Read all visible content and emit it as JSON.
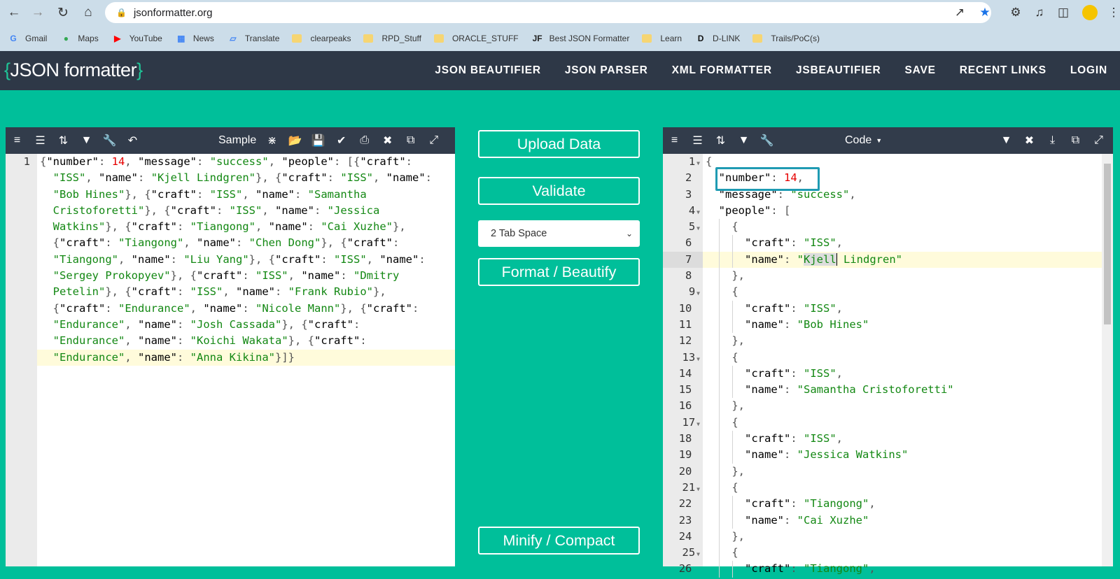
{
  "browser": {
    "url": "jsonformatter.org",
    "bookmarks": [
      {
        "label": "Gmail",
        "icon": "G"
      },
      {
        "label": "Maps",
        "icon": "maps"
      },
      {
        "label": "YouTube",
        "icon": "youtube"
      },
      {
        "label": "News",
        "icon": "news"
      },
      {
        "label": "Translate",
        "icon": "translate"
      },
      {
        "label": "clearpeaks",
        "icon": "folder"
      },
      {
        "label": "RPD_Stuff",
        "icon": "folder"
      },
      {
        "label": "ORACLE_STUFF",
        "icon": "folder"
      },
      {
        "label": "Best JSON Formatter",
        "icon": "JF"
      },
      {
        "label": "Learn",
        "icon": "folder"
      },
      {
        "label": "D-LINK",
        "icon": "D"
      },
      {
        "label": "Trails/PoC(s)",
        "icon": "folder"
      }
    ]
  },
  "site": {
    "logo_open": "{",
    "logo_text": "JSON formatter",
    "logo_close": "}",
    "nav": [
      "JSON BEAUTIFIER",
      "JSON PARSER",
      "XML FORMATTER",
      "JSBEAUTIFIER",
      "SAVE",
      "RECENT LINKS",
      "LOGIN"
    ]
  },
  "left_panel": {
    "sample_label": "Sample",
    "line_number": "1",
    "lines": [
      [
        [
          "p",
          "{"
        ],
        [
          "k",
          "\"number\""
        ],
        [
          "p",
          ": "
        ],
        [
          "n",
          "14"
        ],
        [
          "p",
          ", "
        ],
        [
          "k",
          "\"message\""
        ],
        [
          "p",
          ": "
        ],
        [
          "s",
          "\"success\""
        ],
        [
          "p",
          ", "
        ],
        [
          "k",
          "\"people\""
        ],
        [
          "p",
          ": [{"
        ],
        [
          "k",
          "\"craft\""
        ],
        [
          "p",
          ":"
        ]
      ],
      [
        [
          "p",
          "  "
        ],
        [
          "s",
          "\"ISS\""
        ],
        [
          "p",
          ", "
        ],
        [
          "k",
          "\"name\""
        ],
        [
          "p",
          ": "
        ],
        [
          "s",
          "\"Kjell Lindgren\""
        ],
        [
          "p",
          "}, {"
        ],
        [
          "k",
          "\"craft\""
        ],
        [
          "p",
          ": "
        ],
        [
          "s",
          "\"ISS\""
        ],
        [
          "p",
          ", "
        ],
        [
          "k",
          "\"name\""
        ],
        [
          "p",
          ":"
        ]
      ],
      [
        [
          "p",
          "  "
        ],
        [
          "s",
          "\"Bob Hines\""
        ],
        [
          "p",
          "}, {"
        ],
        [
          "k",
          "\"craft\""
        ],
        [
          "p",
          ": "
        ],
        [
          "s",
          "\"ISS\""
        ],
        [
          "p",
          ", "
        ],
        [
          "k",
          "\"name\""
        ],
        [
          "p",
          ": "
        ],
        [
          "s",
          "\"Samantha"
        ]
      ],
      [
        [
          "s",
          "  Cristoforetti\""
        ],
        [
          "p",
          "}, {"
        ],
        [
          "k",
          "\"craft\""
        ],
        [
          "p",
          ": "
        ],
        [
          "s",
          "\"ISS\""
        ],
        [
          "p",
          ", "
        ],
        [
          "k",
          "\"name\""
        ],
        [
          "p",
          ": "
        ],
        [
          "s",
          "\"Jessica"
        ]
      ],
      [
        [
          "s",
          "  Watkins\""
        ],
        [
          "p",
          "}, {"
        ],
        [
          "k",
          "\"craft\""
        ],
        [
          "p",
          ": "
        ],
        [
          "s",
          "\"Tiangong\""
        ],
        [
          "p",
          ", "
        ],
        [
          "k",
          "\"name\""
        ],
        [
          "p",
          ": "
        ],
        [
          "s",
          "\"Cai Xuzhe\""
        ],
        [
          "p",
          "},"
        ]
      ],
      [
        [
          "p",
          "  {"
        ],
        [
          "k",
          "\"craft\""
        ],
        [
          "p",
          ": "
        ],
        [
          "s",
          "\"Tiangong\""
        ],
        [
          "p",
          ", "
        ],
        [
          "k",
          "\"name\""
        ],
        [
          "p",
          ": "
        ],
        [
          "s",
          "\"Chen Dong\""
        ],
        [
          "p",
          "}, {"
        ],
        [
          "k",
          "\"craft\""
        ],
        [
          "p",
          ":"
        ]
      ],
      [
        [
          "p",
          "  "
        ],
        [
          "s",
          "\"Tiangong\""
        ],
        [
          "p",
          ", "
        ],
        [
          "k",
          "\"name\""
        ],
        [
          "p",
          ": "
        ],
        [
          "s",
          "\"Liu Yang\""
        ],
        [
          "p",
          "}, {"
        ],
        [
          "k",
          "\"craft\""
        ],
        [
          "p",
          ": "
        ],
        [
          "s",
          "\"ISS\""
        ],
        [
          "p",
          ", "
        ],
        [
          "k",
          "\"name\""
        ],
        [
          "p",
          ":"
        ]
      ],
      [
        [
          "p",
          "  "
        ],
        [
          "s",
          "\"Sergey Prokopyev\""
        ],
        [
          "p",
          "}, {"
        ],
        [
          "k",
          "\"craft\""
        ],
        [
          "p",
          ": "
        ],
        [
          "s",
          "\"ISS\""
        ],
        [
          "p",
          ", "
        ],
        [
          "k",
          "\"name\""
        ],
        [
          "p",
          ": "
        ],
        [
          "s",
          "\"Dmitry"
        ]
      ],
      [
        [
          "s",
          "  Petelin\""
        ],
        [
          "p",
          "}, {"
        ],
        [
          "k",
          "\"craft\""
        ],
        [
          "p",
          ": "
        ],
        [
          "s",
          "\"ISS\""
        ],
        [
          "p",
          ", "
        ],
        [
          "k",
          "\"name\""
        ],
        [
          "p",
          ": "
        ],
        [
          "s",
          "\"Frank Rubio\""
        ],
        [
          "p",
          "},"
        ]
      ],
      [
        [
          "p",
          "  {"
        ],
        [
          "k",
          "\"craft\""
        ],
        [
          "p",
          ": "
        ],
        [
          "s",
          "\"Endurance\""
        ],
        [
          "p",
          ", "
        ],
        [
          "k",
          "\"name\""
        ],
        [
          "p",
          ": "
        ],
        [
          "s",
          "\"Nicole Mann\""
        ],
        [
          "p",
          "}, {"
        ],
        [
          "k",
          "\"craft\""
        ],
        [
          "p",
          ":"
        ]
      ],
      [
        [
          "p",
          "  "
        ],
        [
          "s",
          "\"Endurance\""
        ],
        [
          "p",
          ", "
        ],
        [
          "k",
          "\"name\""
        ],
        [
          "p",
          ": "
        ],
        [
          "s",
          "\"Josh Cassada\""
        ],
        [
          "p",
          "}, {"
        ],
        [
          "k",
          "\"craft\""
        ],
        [
          "p",
          ":"
        ]
      ],
      [
        [
          "p",
          "  "
        ],
        [
          "s",
          "\"Endurance\""
        ],
        [
          "p",
          ", "
        ],
        [
          "k",
          "\"name\""
        ],
        [
          "p",
          ": "
        ],
        [
          "s",
          "\"Koichi Wakata\""
        ],
        [
          "p",
          "}, {"
        ],
        [
          "k",
          "\"craft\""
        ],
        [
          "p",
          ":"
        ]
      ],
      [
        [
          "p",
          "  "
        ],
        [
          "s",
          "\"Endurance\""
        ],
        [
          "p",
          ", "
        ],
        [
          "k",
          "\"name\""
        ],
        [
          "p",
          ": "
        ],
        [
          "s",
          "\"Anna Kikina\""
        ],
        [
          "p",
          "}]}"
        ]
      ]
    ]
  },
  "middle": {
    "upload": "Upload Data",
    "validate": "Validate",
    "tab_option": "2 Tab Space",
    "format": "Format / Beautify",
    "minify": "Minify / Compact"
  },
  "right_panel": {
    "mode_label": "Code",
    "lines": [
      {
        "n": "1",
        "fold": true,
        "indent": 0,
        "t": [
          [
            "p",
            "{"
          ]
        ]
      },
      {
        "n": "2",
        "indent": 1,
        "t": [
          [
            "k",
            "\"number\""
          ],
          [
            "p",
            ": "
          ],
          [
            "n",
            "14"
          ],
          [
            "p",
            ","
          ]
        ]
      },
      {
        "n": "3",
        "indent": 1,
        "t": [
          [
            "k",
            "\"message\""
          ],
          [
            "p",
            ": "
          ],
          [
            "s",
            "\"success\""
          ],
          [
            "p",
            ","
          ]
        ]
      },
      {
        "n": "4",
        "fold": true,
        "indent": 1,
        "t": [
          [
            "k",
            "\"people\""
          ],
          [
            "p",
            ": ["
          ]
        ]
      },
      {
        "n": "5",
        "fold": true,
        "indent": 2,
        "t": [
          [
            "p",
            "{"
          ]
        ]
      },
      {
        "n": "6",
        "indent": 3,
        "t": [
          [
            "k",
            "\"craft\""
          ],
          [
            "p",
            ": "
          ],
          [
            "s",
            "\"ISS\""
          ],
          [
            "p",
            ","
          ]
        ]
      },
      {
        "n": "7",
        "indent": 3,
        "hl": true,
        "t": [
          [
            "k",
            "\"name\""
          ],
          [
            "p",
            ": "
          ],
          [
            "s",
            "\""
          ],
          [
            "sel",
            "Kjell"
          ],
          [
            "cur",
            ""
          ],
          [
            "s",
            " Lindgren\""
          ]
        ]
      },
      {
        "n": "8",
        "indent": 2,
        "t": [
          [
            "p",
            "},"
          ]
        ]
      },
      {
        "n": "9",
        "fold": true,
        "indent": 2,
        "t": [
          [
            "p",
            "{"
          ]
        ]
      },
      {
        "n": "10",
        "indent": 3,
        "t": [
          [
            "k",
            "\"craft\""
          ],
          [
            "p",
            ": "
          ],
          [
            "s",
            "\"ISS\""
          ],
          [
            "p",
            ","
          ]
        ]
      },
      {
        "n": "11",
        "indent": 3,
        "t": [
          [
            "k",
            "\"name\""
          ],
          [
            "p",
            ": "
          ],
          [
            "s",
            "\"Bob Hines\""
          ]
        ]
      },
      {
        "n": "12",
        "indent": 2,
        "t": [
          [
            "p",
            "},"
          ]
        ]
      },
      {
        "n": "13",
        "fold": true,
        "indent": 2,
        "t": [
          [
            "p",
            "{"
          ]
        ]
      },
      {
        "n": "14",
        "indent": 3,
        "t": [
          [
            "k",
            "\"craft\""
          ],
          [
            "p",
            ": "
          ],
          [
            "s",
            "\"ISS\""
          ],
          [
            "p",
            ","
          ]
        ]
      },
      {
        "n": "15",
        "indent": 3,
        "t": [
          [
            "k",
            "\"name\""
          ],
          [
            "p",
            ": "
          ],
          [
            "s",
            "\"Samantha Cristoforetti\""
          ]
        ]
      },
      {
        "n": "16",
        "indent": 2,
        "t": [
          [
            "p",
            "},"
          ]
        ]
      },
      {
        "n": "17",
        "fold": true,
        "indent": 2,
        "t": [
          [
            "p",
            "{"
          ]
        ]
      },
      {
        "n": "18",
        "indent": 3,
        "t": [
          [
            "k",
            "\"craft\""
          ],
          [
            "p",
            ": "
          ],
          [
            "s",
            "\"ISS\""
          ],
          [
            "p",
            ","
          ]
        ]
      },
      {
        "n": "19",
        "indent": 3,
        "t": [
          [
            "k",
            "\"name\""
          ],
          [
            "p",
            ": "
          ],
          [
            "s",
            "\"Jessica Watkins\""
          ]
        ]
      },
      {
        "n": "20",
        "indent": 2,
        "t": [
          [
            "p",
            "},"
          ]
        ]
      },
      {
        "n": "21",
        "fold": true,
        "indent": 2,
        "t": [
          [
            "p",
            "{"
          ]
        ]
      },
      {
        "n": "22",
        "indent": 3,
        "t": [
          [
            "k",
            "\"craft\""
          ],
          [
            "p",
            ": "
          ],
          [
            "s",
            "\"Tiangong\""
          ],
          [
            "p",
            ","
          ]
        ]
      },
      {
        "n": "23",
        "indent": 3,
        "t": [
          [
            "k",
            "\"name\""
          ],
          [
            "p",
            ": "
          ],
          [
            "s",
            "\"Cai Xuzhe\""
          ]
        ]
      },
      {
        "n": "24",
        "indent": 2,
        "t": [
          [
            "p",
            "},"
          ]
        ]
      },
      {
        "n": "25",
        "fold": true,
        "indent": 2,
        "t": [
          [
            "p",
            "{"
          ]
        ]
      },
      {
        "n": "26",
        "indent": 3,
        "t": [
          [
            "k",
            "\"craft\""
          ],
          [
            "p",
            ": "
          ],
          [
            "s",
            "\"Tiangong\""
          ],
          [
            "p",
            ","
          ]
        ]
      }
    ]
  }
}
